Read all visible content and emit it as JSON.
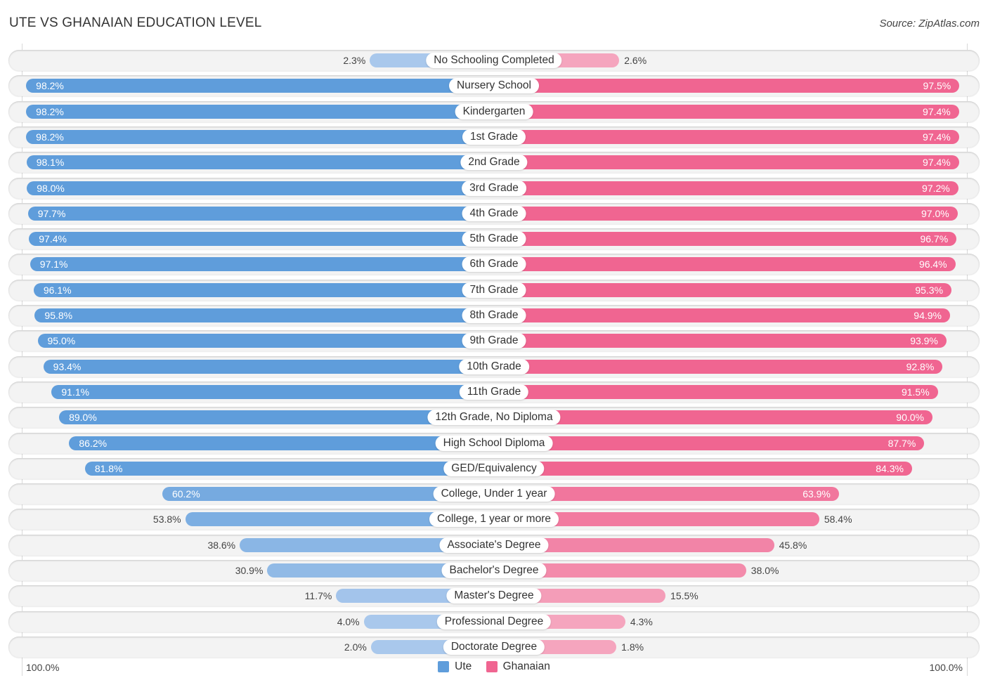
{
  "header": {
    "title": "UTE VS GHANAIAN EDUCATION LEVEL",
    "source": "Source: ZipAtlas.com"
  },
  "axis": {
    "left_label": "100.0%",
    "right_label": "100.0%"
  },
  "legend": {
    "items": [
      {
        "label": "Ute",
        "color": "#5f9ddb"
      },
      {
        "label": "Ghanaian",
        "color": "#f06591"
      }
    ]
  },
  "colors": {
    "ute_strong": "#5f9ddb",
    "ute_light": "#a9c8ec",
    "ghanaian_strong": "#f06591",
    "ghanaian_light": "#f5a5be"
  },
  "chart_data": {
    "type": "bar",
    "orientation": "horizontal-diverging",
    "title": "UTE VS GHANAIAN EDUCATION LEVEL",
    "xlabel": "",
    "ylabel": "",
    "xlim": [
      0,
      100
    ],
    "legend_position": "bottom",
    "categories": [
      "No Schooling Completed",
      "Nursery School",
      "Kindergarten",
      "1st Grade",
      "2nd Grade",
      "3rd Grade",
      "4th Grade",
      "5th Grade",
      "6th Grade",
      "7th Grade",
      "8th Grade",
      "9th Grade",
      "10th Grade",
      "11th Grade",
      "12th Grade, No Diploma",
      "High School Diploma",
      "GED/Equivalency",
      "College, Under 1 year",
      "College, 1 year or more",
      "Associate's Degree",
      "Bachelor's Degree",
      "Master's Degree",
      "Professional Degree",
      "Doctorate Degree"
    ],
    "series": [
      {
        "name": "Ute",
        "side": "left",
        "values": [
          2.3,
          98.2,
          98.2,
          98.2,
          98.1,
          98.0,
          97.7,
          97.4,
          97.1,
          96.1,
          95.8,
          95.0,
          93.4,
          91.1,
          89.0,
          86.2,
          81.8,
          60.2,
          53.8,
          38.6,
          30.9,
          11.7,
          4.0,
          2.0
        ],
        "labels": [
          "2.3%",
          "98.2%",
          "98.2%",
          "98.2%",
          "98.1%",
          "98.0%",
          "97.7%",
          "97.4%",
          "97.1%",
          "96.1%",
          "95.8%",
          "95.0%",
          "93.4%",
          "91.1%",
          "89.0%",
          "86.2%",
          "81.8%",
          "60.2%",
          "53.8%",
          "38.6%",
          "30.9%",
          "11.7%",
          "4.0%",
          "2.0%"
        ]
      },
      {
        "name": "Ghanaian",
        "side": "right",
        "values": [
          2.6,
          97.5,
          97.4,
          97.4,
          97.4,
          97.2,
          97.0,
          96.7,
          96.4,
          95.3,
          94.9,
          93.9,
          92.8,
          91.5,
          90.0,
          87.7,
          84.3,
          63.9,
          58.4,
          45.8,
          38.0,
          15.5,
          4.3,
          1.8
        ],
        "labels": [
          "2.6%",
          "97.5%",
          "97.4%",
          "97.4%",
          "97.4%",
          "97.2%",
          "97.0%",
          "96.7%",
          "96.4%",
          "95.3%",
          "94.9%",
          "93.9%",
          "92.8%",
          "91.5%",
          "90.0%",
          "87.7%",
          "84.3%",
          "63.9%",
          "58.4%",
          "45.8%",
          "38.0%",
          "15.5%",
          "4.3%",
          "1.8%"
        ]
      }
    ]
  }
}
